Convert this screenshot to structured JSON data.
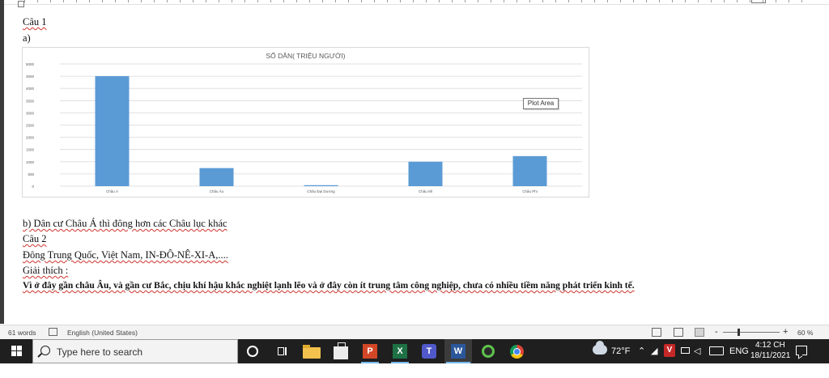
{
  "document": {
    "lines": {
      "cau1": "Câu 1",
      "a": "a)",
      "b": "b) Dân cư Châu Á thì đông hơn các Châu lục khác",
      "cau2": "Câu 2",
      "countries": "Đông Trung Quốc, Việt Nam, IN-ĐÔ-NÊ-XI-A,....",
      "giaithich": "Giải thích :",
      "explanation": "Vì ở đây gần châu Âu, và gần cư Bắc, chịu khí hậu khắc nghiệt lạnh lẽo và ở đây còn ít trung tâm công nghiệp, chưa có nhiều tiềm năng phát triển kinh tế."
    }
  },
  "chart_data": {
    "type": "bar",
    "title": "SỐ DÂN( TRIỆU NGƯỜI)",
    "categories": [
      "Châu Á",
      "Châu Âu",
      "Châu Đại Dương",
      "Châu Mĩ",
      "Châu Phi"
    ],
    "values": [
      4500,
      740,
      40,
      1000,
      1230
    ],
    "ylim": [
      0,
      5000
    ],
    "yticks": [
      0,
      500,
      1000,
      1500,
      2000,
      2500,
      3000,
      3500,
      4000,
      4500,
      5000
    ],
    "grid": true,
    "bar_color": "#5b9bd5",
    "tooltip": "Plot Area"
  },
  "statusbar": {
    "words": "61 words",
    "language": "English (United States)",
    "zoom": "60 %",
    "zoom_minus": "-",
    "zoom_plus": "+"
  },
  "taskbar": {
    "search_placeholder": "Type here to search",
    "temperature": "72°F",
    "language": "ENG",
    "time": "4:12 CH",
    "date": "18/11/2021",
    "apps": [
      "cortana-icon",
      "task-view-icon",
      "file-explorer-icon",
      "store-icon",
      "powerpoint-icon",
      "excel-icon",
      "teams-icon",
      "word-icon",
      "snipping-icon",
      "chrome-icon"
    ],
    "ppt_letter": "P",
    "excel_letter": "X",
    "teams_letter": "T",
    "word_letter": "W",
    "v_letter": "V"
  }
}
